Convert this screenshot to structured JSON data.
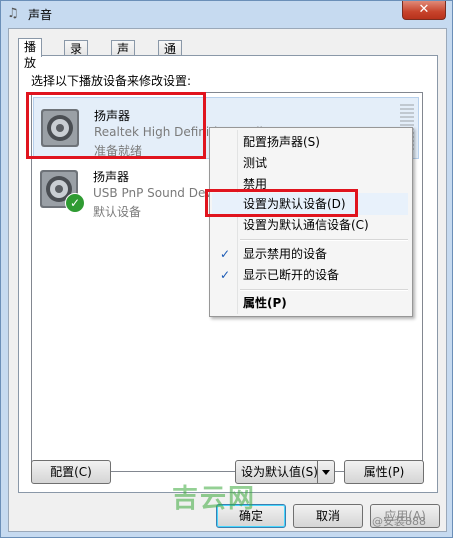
{
  "window": {
    "title": "声音"
  },
  "tabs": [
    "播放",
    "录制",
    "声音",
    "通信"
  ],
  "prompt": "选择以下播放设备来修改设置:",
  "devices": [
    {
      "name": "扬声器",
      "description": "Realtek High Definition Audio",
      "status": "准备就绪"
    },
    {
      "name": "扬声器",
      "description": "USB PnP Sound Device",
      "status": "默认设备"
    }
  ],
  "context_menu": [
    {
      "label": "配置扬声器(S)"
    },
    {
      "label": "测试"
    },
    {
      "label": "禁用"
    },
    {
      "label": "设置为默认设备(D)"
    },
    {
      "label": "设置为默认通信设备(C)"
    },
    {
      "label": "显示禁用的设备",
      "checked": true
    },
    {
      "label": "显示已断开的设备",
      "checked": true
    },
    {
      "label": "属性(P)"
    }
  ],
  "buttons": {
    "configure": "配置(C)",
    "set_default": "设为默认值(S)",
    "properties": "属性(P)",
    "ok": "确定",
    "cancel": "取消",
    "apply": "应用(A)"
  },
  "watermark": {
    "main": "吉云网",
    "corner": "@安装888"
  },
  "colors": {
    "highlight": "#e0141e",
    "default_badge": "#2f9b32"
  }
}
